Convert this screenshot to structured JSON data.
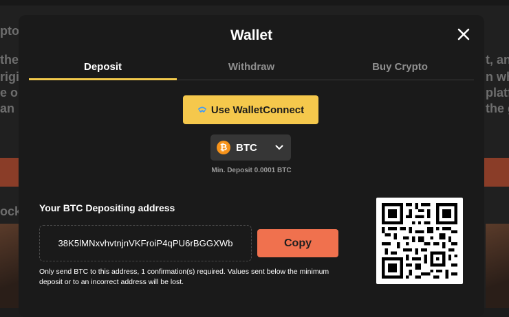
{
  "background": {
    "left_snippets": [
      "pto",
      "the",
      "rigi",
      "e o",
      "an i",
      "ock"
    ],
    "right_snippets": [
      "t, and",
      "n wh",
      "platfo",
      "the g"
    ]
  },
  "modal": {
    "title": "Wallet",
    "close_icon": "close-icon"
  },
  "tabs": [
    {
      "label": "Deposit",
      "active": true
    },
    {
      "label": "Withdraw",
      "active": false
    },
    {
      "label": "Buy Crypto",
      "active": false
    }
  ],
  "walletconnect": {
    "label": "Use WalletConnect",
    "icon": "walletconnect-icon",
    "color": "#f5c84c"
  },
  "coin_select": {
    "selected": "BTC",
    "icon": "bitcoin-icon"
  },
  "min_deposit": "Min. Deposit 0.0001 BTC",
  "address": {
    "label": "Your BTC Depositing address",
    "value": "38K5lMNxvhvtnjnVKFroiP4qPU6rBGGXWb",
    "copy_label": "Copy",
    "note": "Only send BTC to this address, 1 confirmation(s) required. Values sent below the minimum deposit or to an incorrect address will be lost."
  },
  "colors": {
    "accent": "#f2c94c",
    "copy": "#f0714e",
    "bitcoin": "#f7931a"
  }
}
